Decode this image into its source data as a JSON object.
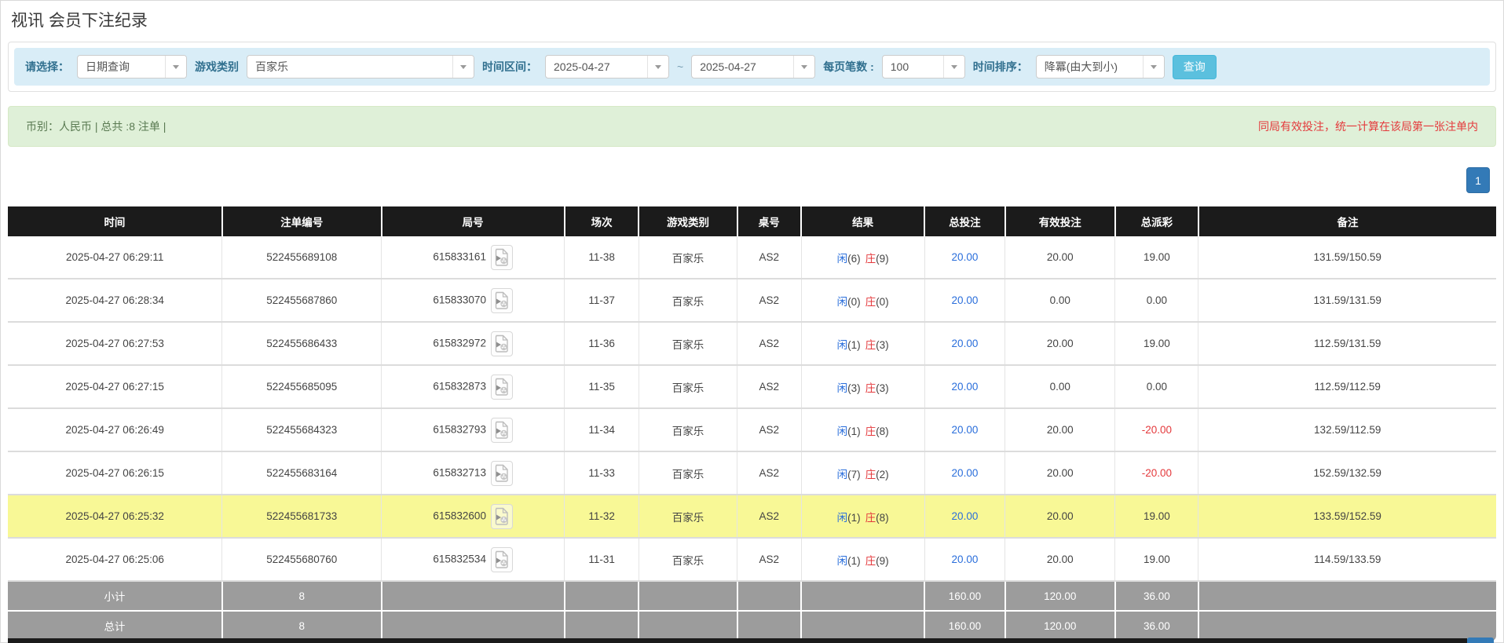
{
  "page": {
    "title": "视讯 会员下注纪录"
  },
  "colors": {
    "header_bg": "#1b1b1b",
    "filter_bg": "#d9edf7",
    "label_blue": "#31708f",
    "search_btn": "#5bc0de",
    "summary_bg": "#dff0d8",
    "summary_text": "#5a7a52",
    "alert_red": "#e43a3c",
    "page_blue": "#337ab7",
    "link_blue": "#2a6edb",
    "player_blue": "#2a6edb",
    "banker_red": "#e4393c",
    "highlight": "#f8f896",
    "totals_gray": "#9c9c9c",
    "panel_border": "#e0e0e0"
  },
  "icons": {
    "dropdown_arrow": "chevron-down",
    "round_media": "video-file"
  },
  "filters": {
    "select_label": "请选择：",
    "select_value": "日期查询",
    "game_label": "游戏类别",
    "game_value": "百家乐",
    "range_label": "时间区间：",
    "date_from": "2025-04-27",
    "tilde": "~",
    "date_to": "2025-04-27",
    "per_page_label": "每页笔数 :",
    "per_page_value": "100",
    "sort_label": "时间排序：",
    "sort_value": "降冪(由大到小)",
    "search_button": "查询"
  },
  "summary": {
    "left_text": "币别：人民币 | 总共 :8 注单 |",
    "right_text": "同局有效投注，统一计算在该局第一张注单内"
  },
  "pagination": {
    "page": "1"
  },
  "table": {
    "headers": [
      "时间",
      "注单编号",
      "局号",
      "场次",
      "游戏类别",
      "桌号",
      "结果",
      "总投注",
      "有效投注",
      "总派彩",
      "备注"
    ],
    "rows": [
      {
        "time": "2025-04-27 06:29:11",
        "bet_id": "522455689108",
        "round": "615833161",
        "session": "11-38",
        "game": "百家乐",
        "table_no": "AS2",
        "result_p": "闲",
        "result_p_val": "(6)",
        "result_b": "庄",
        "result_b_val": "(9)",
        "total_bet": "20.00",
        "valid_bet": "20.00",
        "payout": "19.00",
        "remark": "131.59/150.59",
        "highlight": false
      },
      {
        "time": "2025-04-27 06:28:34",
        "bet_id": "522455687860",
        "round": "615833070",
        "session": "11-37",
        "game": "百家乐",
        "table_no": "AS2",
        "result_p": "闲",
        "result_p_val": "(0)",
        "result_b": "庄",
        "result_b_val": "(0)",
        "total_bet": "20.00",
        "valid_bet": "0.00",
        "payout": "0.00",
        "remark": "131.59/131.59",
        "highlight": false
      },
      {
        "time": "2025-04-27 06:27:53",
        "bet_id": "522455686433",
        "round": "615832972",
        "session": "11-36",
        "game": "百家乐",
        "table_no": "AS2",
        "result_p": "闲",
        "result_p_val": "(1)",
        "result_b": "庄",
        "result_b_val": "(3)",
        "total_bet": "20.00",
        "valid_bet": "20.00",
        "payout": "19.00",
        "remark": "112.59/131.59",
        "highlight": false
      },
      {
        "time": "2025-04-27 06:27:15",
        "bet_id": "522455685095",
        "round": "615832873",
        "session": "11-35",
        "game": "百家乐",
        "table_no": "AS2",
        "result_p": "闲",
        "result_p_val": "(3)",
        "result_b": "庄",
        "result_b_val": "(3)",
        "total_bet": "20.00",
        "valid_bet": "0.00",
        "payout": "0.00",
        "remark": "112.59/112.59",
        "highlight": false
      },
      {
        "time": "2025-04-27 06:26:49",
        "bet_id": "522455684323",
        "round": "615832793",
        "session": "11-34",
        "game": "百家乐",
        "table_no": "AS2",
        "result_p": "闲",
        "result_p_val": "(1)",
        "result_b": "庄",
        "result_b_val": "(8)",
        "total_bet": "20.00",
        "valid_bet": "20.00",
        "payout": "-20.00",
        "remark": "132.59/112.59",
        "highlight": false
      },
      {
        "time": "2025-04-27 06:26:15",
        "bet_id": "522455683164",
        "round": "615832713",
        "session": "11-33",
        "game": "百家乐",
        "table_no": "AS2",
        "result_p": "闲",
        "result_p_val": "(7)",
        "result_b": "庄",
        "result_b_val": "(2)",
        "total_bet": "20.00",
        "valid_bet": "20.00",
        "payout": "-20.00",
        "remark": "152.59/132.59",
        "highlight": false
      },
      {
        "time": "2025-04-27 06:25:32",
        "bet_id": "522455681733",
        "round": "615832600",
        "session": "11-32",
        "game": "百家乐",
        "table_no": "AS2",
        "result_p": "闲",
        "result_p_val": "(1)",
        "result_b": "庄",
        "result_b_val": "(8)",
        "total_bet": "20.00",
        "valid_bet": "20.00",
        "payout": "19.00",
        "remark": "133.59/152.59",
        "highlight": true
      },
      {
        "time": "2025-04-27 06:25:06",
        "bet_id": "522455680760",
        "round": "615832534",
        "session": "11-31",
        "game": "百家乐",
        "table_no": "AS2",
        "result_p": "闲",
        "result_p_val": "(1)",
        "result_b": "庄",
        "result_b_val": "(9)",
        "total_bet": "20.00",
        "valid_bet": "20.00",
        "payout": "19.00",
        "remark": "114.59/133.59",
        "highlight": false
      }
    ],
    "subtotal": {
      "label": "小计",
      "count": "8",
      "total_bet": "160.00",
      "valid_bet": "120.00",
      "payout": "36.00"
    },
    "total": {
      "label": "总计",
      "count": "8",
      "total_bet": "160.00",
      "valid_bet": "120.00",
      "payout": "36.00"
    }
  }
}
